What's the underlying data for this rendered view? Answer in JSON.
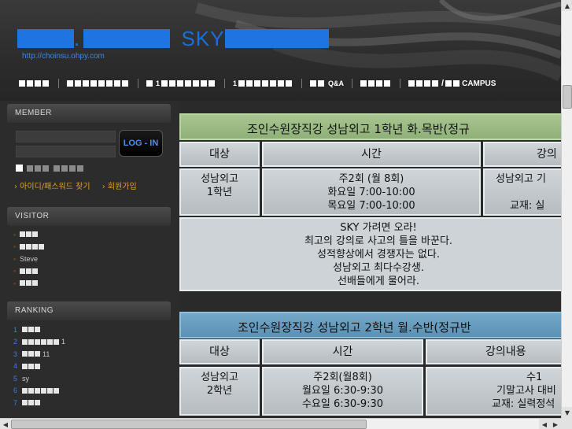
{
  "header": {
    "logo_text": "SKY",
    "url": "http://choinsu.ohpy.com",
    "nav": [
      {
        "label": ""
      },
      {
        "label": ""
      },
      {
        "label": "1"
      },
      {
        "label": "1"
      },
      {
        "label": "Q&A"
      },
      {
        "label": ""
      },
      {
        "label": "CAMPUS"
      }
    ]
  },
  "sidebar": {
    "member_title": "MEMBER",
    "login_label": "LOG - IN",
    "find_label": "› 아이디/패스워드 찾기",
    "join_label": "› 회원가입",
    "visitor_title": "VISITOR",
    "visitors": [
      "",
      "",
      "Steve",
      "",
      ""
    ],
    "ranking_title": "RANKING",
    "ranking": [
      {
        "num": "1",
        "text": ""
      },
      {
        "num": "2",
        "text": "1"
      },
      {
        "num": "3",
        "text": "11"
      },
      {
        "num": "4",
        "text": ""
      },
      {
        "num": "5",
        "text": "sy"
      },
      {
        "num": "6",
        "text": ""
      },
      {
        "num": "7",
        "text": ""
      }
    ]
  },
  "main": {
    "table1": {
      "title": "조인수원장직강  성남외고 1학년   화.목반(정규",
      "headers": [
        "대상",
        "시간",
        "강의"
      ],
      "target": [
        "성남외고",
        "1학년"
      ],
      "time": [
        "주2회 (월 8회)",
        "화요일  7:00-10:00",
        "목요일  7:00-10:00"
      ],
      "content": [
        "성남외고  기",
        "",
        "교재: 실"
      ],
      "note": [
        "SKY 가려면 오라!",
        "최고의 강의로 사고의 틀을 바꾼다.",
        "성적향상에서 경쟁자는 없다.",
        "성남외고  최다수강생.",
        "선배들에게 물어라."
      ]
    },
    "table2": {
      "title": "조인수원장직강  성남외고  2학년  월.수반(정규반",
      "headers": [
        "대상",
        "시간",
        "강의내용"
      ],
      "target": [
        "성남외고",
        "2학년"
      ],
      "time": [
        "주2회(월8회)",
        "월요일   6:30-9:30",
        "수요일   6:30-9:30"
      ],
      "content": [
        "수1",
        "기말고사 대비",
        "교재: 실력정석"
      ]
    }
  },
  "colors": {
    "accent": "#1e74e0",
    "table1_title_bg": "#9dbd86",
    "table2_title_bg": "#6aa0c0",
    "link": "#e0a020"
  }
}
